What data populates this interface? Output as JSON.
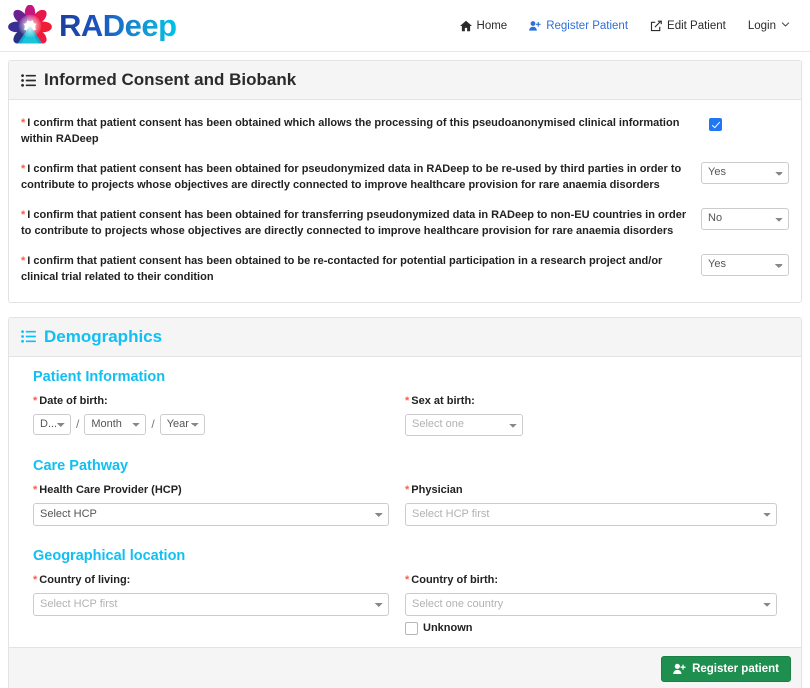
{
  "brand": {
    "name": "RADeep",
    "logo_icon": "flower-logo-icon"
  },
  "nav": {
    "items": [
      {
        "label": "Home",
        "icon": "home-icon",
        "active": false
      },
      {
        "label": "Register Patient",
        "icon": "user-plus-icon",
        "active": true
      },
      {
        "label": "Edit Patient",
        "icon": "edit-square-icon",
        "active": false
      },
      {
        "label": "Login",
        "icon": "chevron-down-icon",
        "active": false
      }
    ]
  },
  "consent_panel": {
    "title": "Informed Consent and Biobank",
    "icon": "list-icon",
    "rows": [
      {
        "required_mark": "*",
        "text": "I confirm that patient consent has been obtained which allows the processing of this pseudoanonymised clinical information within RADeep",
        "control": "checkbox",
        "checked": true
      },
      {
        "required_mark": "*",
        "text": "I confirm that patient consent has been obtained for pseudonymized data in RADeep to be re-used by third parties in order to contribute to projects whose objectives are directly connected to improve healthcare provision for rare anaemia disorders",
        "control": "select",
        "value": "Yes",
        "options": [
          "Yes",
          "No"
        ]
      },
      {
        "required_mark": "*",
        "text": "I confirm that patient consent has been obtained for transferring pseudonymized data in RADeep to non-EU countries in order to contribute to projects whose objectives are directly connected to improve healthcare provision for rare anaemia disorders",
        "control": "select",
        "value": "No",
        "options": [
          "Yes",
          "No"
        ]
      },
      {
        "required_mark": "*",
        "text": "I confirm that patient consent has been obtained to be re-contacted for potential participation in a research project and/or clinical trial related to their condition",
        "control": "select",
        "value": "Yes",
        "options": [
          "Yes",
          "No"
        ]
      }
    ]
  },
  "demographics_panel": {
    "title": "Demographics",
    "icon": "list-icon",
    "sections": {
      "patient_information": {
        "heading": "Patient Information",
        "dob_label": "Date of birth:",
        "dob_required": "*",
        "day_value": "D...",
        "month_value": "Month",
        "year_value": "Year",
        "separator": "/",
        "sex_label": "Sex at birth:",
        "sex_required": "*",
        "sex_value": "Select one"
      },
      "care_pathway": {
        "heading": "Care Pathway",
        "hcp_label": "Health Care Provider (HCP)",
        "hcp_required": "*",
        "hcp_value": "Select HCP",
        "physician_label": "Physician",
        "physician_required": "*",
        "physician_value": "Select HCP first"
      },
      "geographical_location": {
        "heading": "Geographical location",
        "country_living_label": "Country of living:",
        "country_living_required": "*",
        "country_living_value": "Select HCP first",
        "country_birth_label": "Country of birth:",
        "country_birth_required": "*",
        "country_birth_value": "Select one country",
        "unknown_label": "Unknown",
        "unknown_checked": false
      }
    },
    "footer": {
      "submit_label": "Register patient",
      "submit_icon": "user-plus-icon",
      "submit_color": "#1e8f4e"
    }
  },
  "colors": {
    "accent_cyan": "#11c0f2",
    "link_blue": "#2e6fd9",
    "required_red": "#ff5b4a",
    "checkbox_blue": "#2176f3",
    "panel_head_bg": "#f5f5f5"
  }
}
